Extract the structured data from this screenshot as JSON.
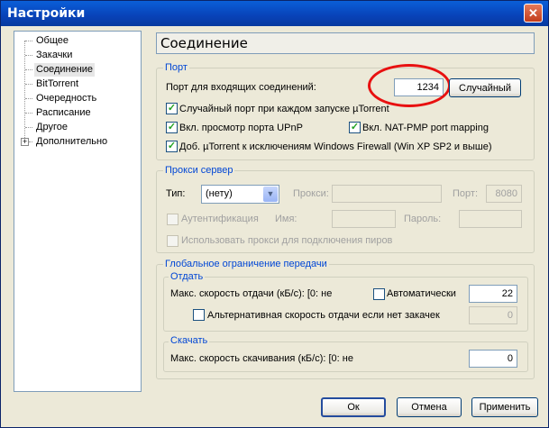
{
  "window": {
    "title": "Настройки"
  },
  "tree": {
    "items": [
      "Общее",
      "Закачки",
      "Соединение",
      "BitTorrent",
      "Очередность",
      "Расписание",
      "Другое",
      "Дополнительно"
    ],
    "selected": "Соединение"
  },
  "header": {
    "title": "Соединение"
  },
  "port": {
    "legend": "Порт",
    "label": "Порт для входящих соединений:",
    "value": "1234",
    "random_button": "Случайный",
    "random_each_start": "Случайный порт при каждом запуске µTorrent",
    "upnp": "Вкл. просмотр порта UPnP",
    "natpmp": "Вкл. NAT-PMP port mapping",
    "firewall": "Доб. µTorrent к исключениям Windows Firewall (Win XP SP2 и выше)"
  },
  "proxy": {
    "legend": "Прокси сервер",
    "type_label": "Тип:",
    "type_value": "(нету)",
    "proxy_label": "Прокси:",
    "port_label": "Порт:",
    "port_value": "8080",
    "auth_label": "Аутентификация",
    "name_label": "Имя:",
    "password_label": "Пароль:",
    "peer_label": "Использовать прокси для подключения пиров"
  },
  "limits": {
    "legend": "Глобальное ограничение передачи",
    "upload": {
      "legend": "Отдать",
      "max_label": "Макс. скорость отдачи (кБ/с): [0: не",
      "auto_label": "Автоматически",
      "max_value": "22",
      "alt_label": "Альтернативная скорость отдачи если нет закачек",
      "alt_value": "0"
    },
    "download": {
      "legend": "Скачать",
      "max_label": "Макс. скорость скачивания (кБ/с): [0: не",
      "max_value": "0"
    }
  },
  "buttons": {
    "ok": "Ок",
    "cancel": "Отмена",
    "apply": "Применить"
  }
}
